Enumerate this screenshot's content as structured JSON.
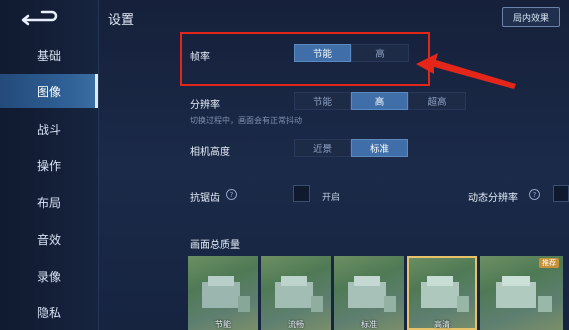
{
  "header": {
    "title": "设置",
    "effect_button": "局内效果"
  },
  "sidebar": {
    "items": [
      {
        "label": "基础",
        "active": false
      },
      {
        "label": "图像",
        "active": true
      },
      {
        "label": "战斗",
        "active": false
      },
      {
        "label": "操作",
        "active": false
      },
      {
        "label": "布局",
        "active": false
      },
      {
        "label": "音效",
        "active": false
      },
      {
        "label": "录像",
        "active": false
      },
      {
        "label": "隐私",
        "active": false
      }
    ]
  },
  "settings": {
    "frame_rate": {
      "label": "帧率",
      "options": [
        "节能",
        "高"
      ],
      "selected": "节能"
    },
    "resolution": {
      "label": "分辨率",
      "options": [
        "节能",
        "高",
        "超高"
      ],
      "selected": "高",
      "hint": "切换过程中，画面会有正常抖动"
    },
    "camera_height": {
      "label": "相机高度",
      "options": [
        "近景",
        "标准"
      ],
      "selected": "标准"
    },
    "antialias": {
      "label": "抗锯齿",
      "help_icon": "?",
      "toggle_label": "开启",
      "checked": false
    },
    "dynamic_resolution": {
      "label": "动态分辨率",
      "help_icon": "?"
    },
    "quality": {
      "label": "画面总质量",
      "thumbnails": [
        {
          "caption": "节能",
          "selected": false
        },
        {
          "caption": "流畅",
          "selected": false
        },
        {
          "caption": "标准",
          "selected": false
        },
        {
          "caption": "高清",
          "selected": true
        },
        {
          "caption": "",
          "badge": "推荐",
          "selected": false
        }
      ]
    }
  },
  "annotation": {
    "color": "#e32619"
  }
}
